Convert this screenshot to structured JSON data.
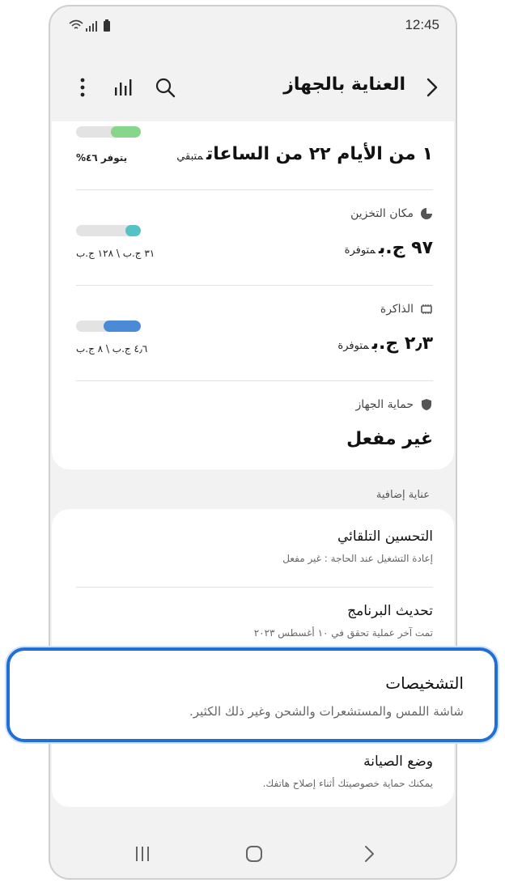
{
  "status_bar": {
    "time": "12:45"
  },
  "app_bar": {
    "title": "العناية بالجهاز"
  },
  "battery": {
    "value": "١ من الأيام ٢٢ من الساعات",
    "suffix": "متبقي",
    "caption": "يتوفر ٤٦%",
    "level": 0.46,
    "color": "#86d68b"
  },
  "storage": {
    "label": "مكان التخزين",
    "value": "٩٧ ج.ب",
    "suffix": "متوفرة",
    "caption": "٣١ ج.ب \\ ١٢٨ ج.ب",
    "level": 0.24,
    "color": "#55c3c6"
  },
  "memory": {
    "label": "الذاكرة",
    "value": "٢٫٣ ج.ب",
    "suffix": "متوفرة",
    "caption": "٤٫٦ ج.ب \\ ٨ ج.ب",
    "level": 0.57,
    "color": "#4a8ad6"
  },
  "protection": {
    "label": "حماية الجهاز",
    "value": "غير مفعل"
  },
  "extra_section": {
    "header": "عناية إضافية",
    "items": [
      {
        "title": "التحسين التلقائي",
        "subtitle": "إعادة التشغيل عند الحاجة : غير مفعل"
      },
      {
        "title": "تحديث البرنامج",
        "subtitle": "تمت آخر عملية تحقق في ١٠ أغسطس ٢٠٢٣"
      },
      {
        "title": "التشخيصات",
        "subtitle": "شاشة اللمس والمستشعرات والشحن وغير ذلك الكثير."
      },
      {
        "title": "وضع الصيانة",
        "subtitle": "يمكنك حماية خصوصيتك أثناء إصلاح هاتفك."
      }
    ]
  },
  "colors": {
    "highlight": "#1f6fd6"
  },
  "icons": [
    "wifi-icon",
    "signal-icon",
    "battery-icon",
    "back-icon",
    "search-icon",
    "chart-icon",
    "more-icon",
    "pie-icon",
    "chip-icon",
    "shield-icon",
    "recents-icon",
    "home-icon",
    "nav-back-icon"
  ]
}
